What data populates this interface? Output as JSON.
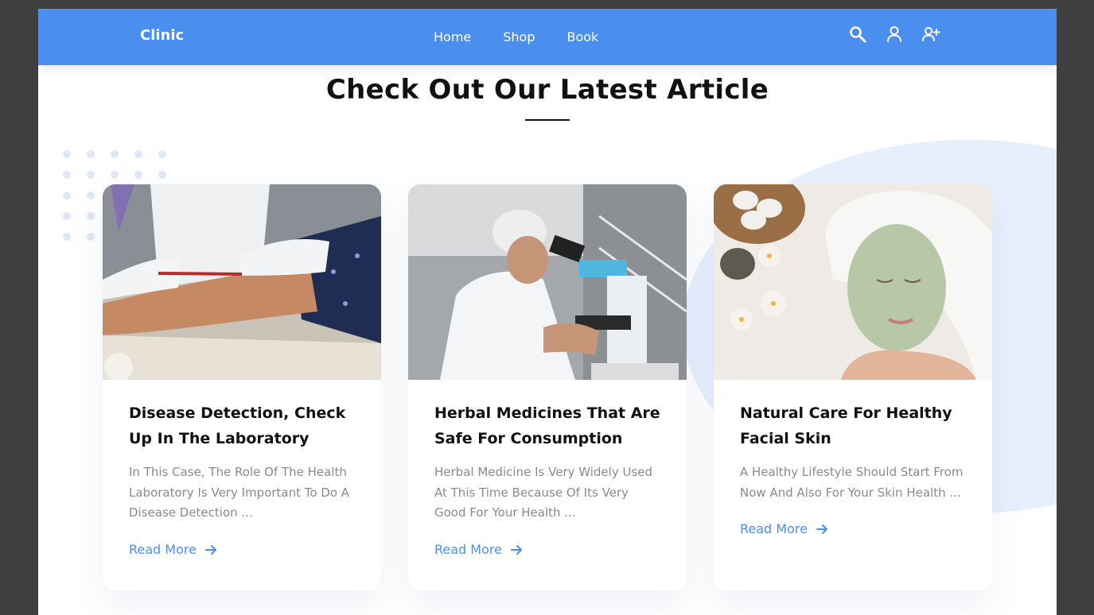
{
  "navbar": {
    "brand": "Clinic",
    "links": [
      "Home",
      "Shop",
      "Book"
    ],
    "icons": [
      "search-icon",
      "user-icon",
      "add-user-icon"
    ]
  },
  "section": {
    "title": "Check Out Our Latest Article"
  },
  "articles": [
    {
      "title": "Disease Detection, Check Up In The Laboratory",
      "description": "In This Case, The Role Of The Health Laboratory Is Very Important To Do A Disease Detection ...",
      "link": "Read More",
      "image": "blood-test-photo"
    },
    {
      "title": "Herbal Medicines That Are Safe For Consumption",
      "description": "Herbal Medicine Is Very Widely Used At This Time Because Of Its Very Good For Your Health ...",
      "link": "Read More",
      "image": "microscope-lab-photo"
    },
    {
      "title": "Natural Care For Healthy Facial Skin",
      "description": "A Healthy Lifestyle Should Start From Now And Also For Your Skin Health ...",
      "link": "Read More",
      "image": "facial-mask-spa-photo"
    }
  ],
  "colors": {
    "accent": "#4a8ff0",
    "heading": "#111111",
    "body_text": "#8a8a8a",
    "blob": "#e6f0fd",
    "frame": "#3f3f3f"
  }
}
